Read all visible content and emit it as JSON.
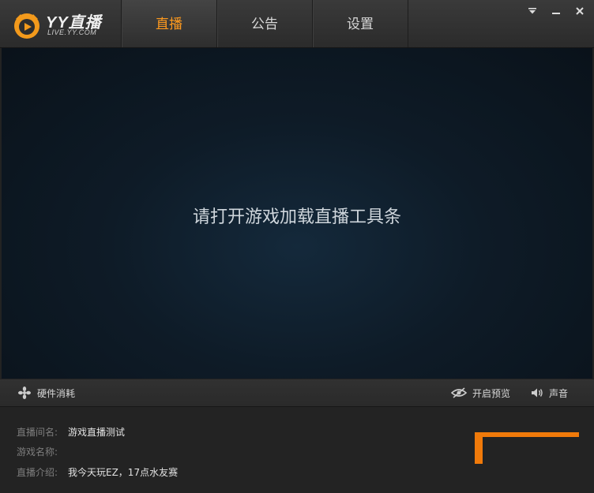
{
  "logo": {
    "name": "YY直播",
    "sub": "LIVE.YY.COM"
  },
  "tabs": [
    {
      "label": "直播",
      "active": true
    },
    {
      "label": "公告",
      "active": false
    },
    {
      "label": "设置",
      "active": false
    }
  ],
  "preview": {
    "message": "请打开游戏加载直播工具条"
  },
  "toolbar": {
    "hardware": "硬件消耗",
    "preview_toggle": "开启预览",
    "sound": "声音"
  },
  "info": {
    "rows": [
      {
        "label": "直播间名:",
        "value": "游戏直播测试"
      },
      {
        "label": "游戏名称:",
        "value": ""
      },
      {
        "label": "直播介绍:",
        "value": "我今天玩EZ，17点水友赛"
      }
    ]
  },
  "colors": {
    "accent": "#ff9a1e",
    "bracket": "#f07a0a"
  }
}
